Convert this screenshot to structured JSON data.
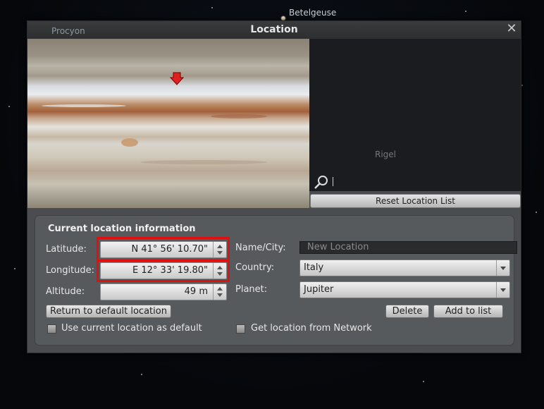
{
  "sky": {
    "star_labels": [
      "Betelgeuse",
      "Procyon",
      "Rigel"
    ]
  },
  "window": {
    "title": "Location",
    "close_icon": "close-icon"
  },
  "map": {
    "planet_texture": "jupiter-map",
    "marker_icon": "location-pointer-icon"
  },
  "search": {
    "icon": "search-icon",
    "value": ""
  },
  "reset_button_label": "Reset Location List",
  "current_location": {
    "group_title": "Current location information",
    "latitude_label": "Latitude:",
    "latitude_value": "N 41° 56' 10.70\"",
    "longitude_label": "Longitude:",
    "longitude_value": "E 12° 33' 19.80\"",
    "altitude_label": "Altitude:",
    "altitude_value": "49 m",
    "name_label": "Name/City:",
    "name_placeholder": "New Location",
    "country_label": "Country:",
    "country_value": "Italy",
    "planet_label": "Planet:",
    "planet_value": "Jupiter",
    "return_button": "Return to default location",
    "delete_button": "Delete",
    "add_button": "Add to list",
    "use_default_label": "Use current location as default",
    "network_label": "Get location from Network",
    "use_default_checked": false,
    "network_checked": false
  },
  "colors": {
    "highlight": "#e01010",
    "window_bg": "#4a4c4f",
    "group_bg": "#575a5d"
  }
}
